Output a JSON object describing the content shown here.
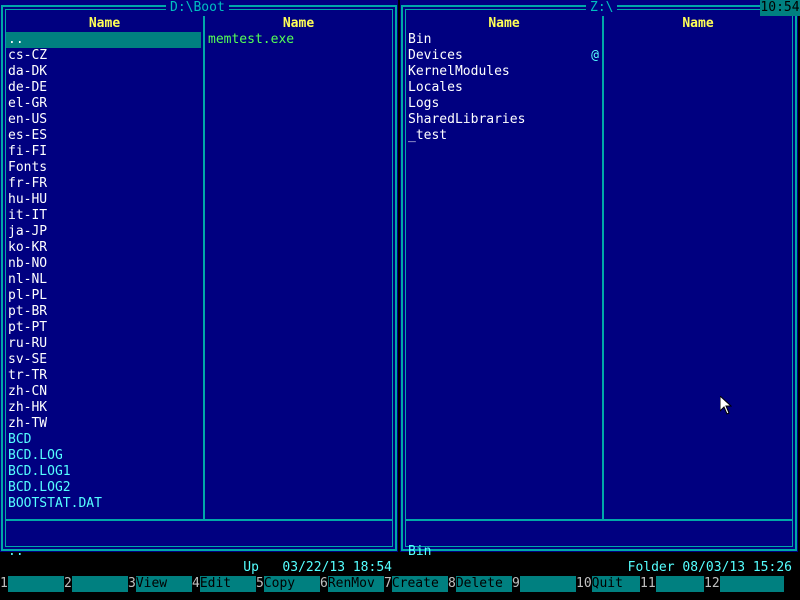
{
  "left_panel": {
    "path": "D:\\Boot",
    "col1_header": "Name",
    "col2_header": "Name",
    "col1_items": [
      {
        "name": "..",
        "type": "dir",
        "selected": true
      },
      {
        "name": "cs-CZ",
        "type": "dir"
      },
      {
        "name": "da-DK",
        "type": "dir"
      },
      {
        "name": "de-DE",
        "type": "dir"
      },
      {
        "name": "el-GR",
        "type": "dir"
      },
      {
        "name": "en-US",
        "type": "dir"
      },
      {
        "name": "es-ES",
        "type": "dir"
      },
      {
        "name": "fi-FI",
        "type": "dir"
      },
      {
        "name": "Fonts",
        "type": "dir"
      },
      {
        "name": "fr-FR",
        "type": "dir"
      },
      {
        "name": "hu-HU",
        "type": "dir"
      },
      {
        "name": "it-IT",
        "type": "dir"
      },
      {
        "name": "ja-JP",
        "type": "dir"
      },
      {
        "name": "ko-KR",
        "type": "dir"
      },
      {
        "name": "nb-NO",
        "type": "dir"
      },
      {
        "name": "nl-NL",
        "type": "dir"
      },
      {
        "name": "pl-PL",
        "type": "dir"
      },
      {
        "name": "pt-BR",
        "type": "dir"
      },
      {
        "name": "pt-PT",
        "type": "dir"
      },
      {
        "name": "ru-RU",
        "type": "dir"
      },
      {
        "name": "sv-SE",
        "type": "dir"
      },
      {
        "name": "tr-TR",
        "type": "dir"
      },
      {
        "name": "zh-CN",
        "type": "dir"
      },
      {
        "name": "zh-HK",
        "type": "dir"
      },
      {
        "name": "zh-TW",
        "type": "dir"
      },
      {
        "name": "BCD",
        "type": "file"
      },
      {
        "name": "BCD.LOG",
        "type": "file"
      },
      {
        "name": "BCD.LOG1",
        "type": "file"
      },
      {
        "name": "BCD.LOG2",
        "type": "file"
      },
      {
        "name": "BOOTSTAT.DAT",
        "type": "file"
      }
    ],
    "col2_items": [
      {
        "name": "memtest.exe",
        "type": "exe"
      }
    ],
    "info": {
      "name": "..",
      "meta": "Up   03/22/13 18:54"
    }
  },
  "right_panel": {
    "path": "Z:\\",
    "col1_header": "Name",
    "col2_header": "Name",
    "col1_items": [
      {
        "name": "Bin",
        "type": "dir"
      },
      {
        "name": "Devices",
        "type": "dir",
        "marker": "@"
      },
      {
        "name": "KernelModules",
        "type": "dir"
      },
      {
        "name": "Locales",
        "type": "dir"
      },
      {
        "name": "Logs",
        "type": "dir"
      },
      {
        "name": "SharedLibraries",
        "type": "dir"
      },
      {
        "name": "_test",
        "type": "dir"
      }
    ],
    "col2_items": [],
    "info": {
      "name": "Bin",
      "meta": "Folder 08/03/13 15:26"
    }
  },
  "clock": "10:54",
  "function_keys": [
    {
      "num": "1",
      "label": ""
    },
    {
      "num": "2",
      "label": ""
    },
    {
      "num": "3",
      "label": "View"
    },
    {
      "num": "4",
      "label": "Edit"
    },
    {
      "num": "5",
      "label": "Copy"
    },
    {
      "num": "6",
      "label": "RenMov"
    },
    {
      "num": "7",
      "label": "Create"
    },
    {
      "num": "8",
      "label": "Delete"
    },
    {
      "num": "9",
      "label": ""
    },
    {
      "num": "10",
      "label": "Quit"
    },
    {
      "num": "11",
      "label": ""
    },
    {
      "num": "12",
      "label": ""
    }
  ],
  "colors": {
    "panel_bg": "#000080",
    "frame": "#00A8A8",
    "header": "#FFFF55",
    "dir": "#FFFFFF",
    "file": "#55FFFF",
    "exe": "#55FF55",
    "selection": "#008080"
  },
  "icons": {
    "cursor": "mouse-pointer-icon"
  }
}
